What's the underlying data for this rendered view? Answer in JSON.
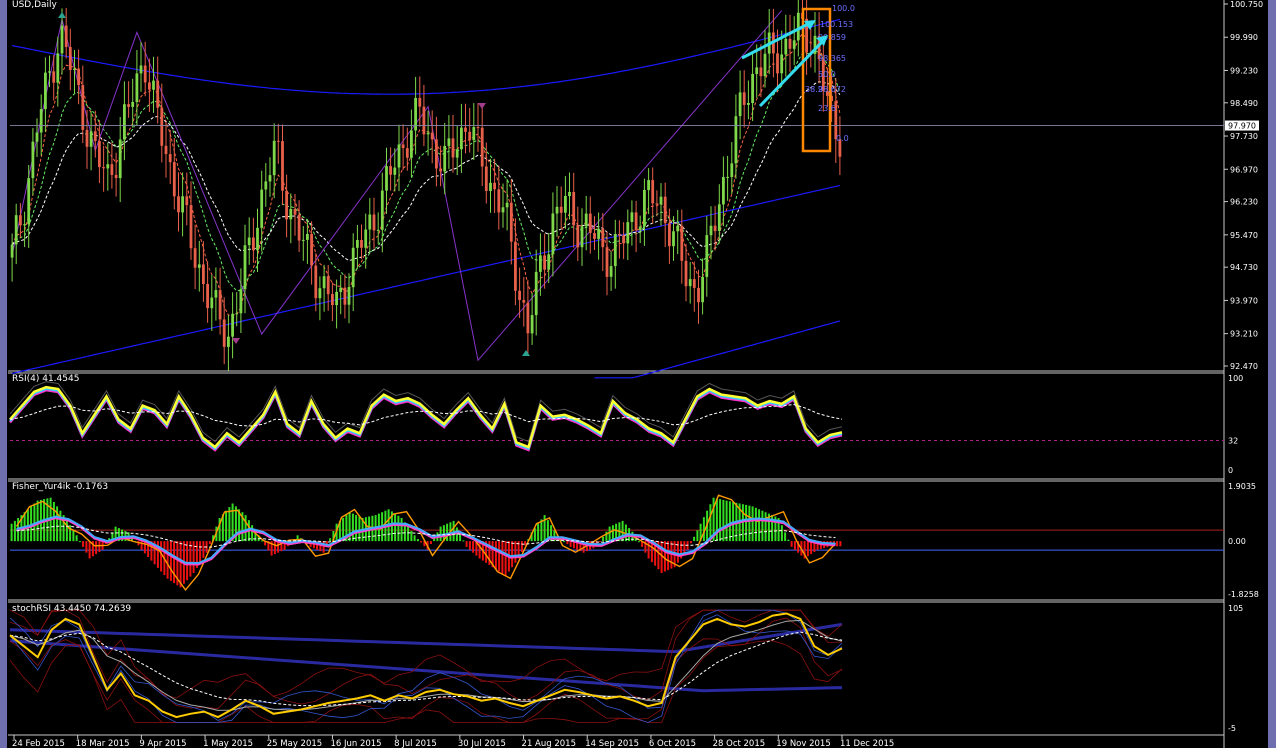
{
  "window": {
    "title": "USD,Daily"
  },
  "colors": {
    "bull": "#7fd84a",
    "bear": "#e8604a",
    "ma_blue": "#1a1aff",
    "rsi_main": "#ffff33",
    "rsi_pink": "#ff33cc",
    "rsi_cyan": "#33ccff",
    "fisher_pos": "#33dd22",
    "fisher_neg": "#ee1111",
    "fisher_line": "#ff9900",
    "stoch_line": "#ffcc00",
    "fib_box": "#ff8800",
    "arrow": "#33ddee"
  },
  "icons": {
    "up_arrow": "arrow-up-icon",
    "down_arrow": "arrow-down-icon"
  },
  "chart_data": [
    {
      "type": "candlestick",
      "title": "USD,Daily",
      "ylim": [
        92.47,
        100.75
      ],
      "y_ticks": [
        "100.750",
        "99.990",
        "99.230",
        "98.490",
        "97.730",
        "96.970",
        "96.230",
        "95.470",
        "94.730",
        "93.970",
        "93.210",
        "92.470"
      ],
      "current_price_label": "97.970",
      "fib_levels": [
        "100.0",
        "100.153",
        "99.859",
        "98.365",
        "50.0",
        "38.2",
        "98.672",
        "23.6",
        "0.0"
      ],
      "x_labels": [
        "24 Feb 2015",
        "18 Mar 2015",
        "9 Apr 2015",
        "1 May 2015",
        "25 May 2015",
        "16 Jun 2015",
        "8 Jul 2015",
        "30 Jul 2015",
        "21 Aug 2015",
        "14 Sep 2015",
        "6 Oct 2015",
        "28 Oct 2015",
        "19 Nov 2015",
        "11 Dec 2015"
      ],
      "close_path": [
        95.0,
        96.2,
        97.8,
        99.0,
        100.1,
        99.2,
        98.2,
        97.2,
        96.8,
        97.6,
        98.6,
        99.6,
        98.2,
        97.2,
        96.2,
        95.2,
        94.4,
        93.6,
        93.2,
        94.2,
        95.4,
        96.6,
        97.4,
        96.2,
        95.4,
        94.8,
        94.2,
        93.8,
        94.6,
        95.2,
        95.8,
        96.4,
        97.2,
        97.8,
        98.2,
        97.6,
        97.0,
        97.6,
        98.1,
        97.2,
        96.6,
        96.0,
        94.6,
        93.3,
        94.6,
        95.8,
        96.2,
        95.8,
        95.6,
        95.2,
        95.0,
        95.4,
        96.0,
        96.3,
        96.2,
        95.6,
        94.6,
        94.2,
        95.0,
        96.4,
        97.4,
        98.6,
        99.3,
        99.5,
        99.7,
        99.9,
        100.2,
        99.8,
        98.3,
        97.8
      ]
    },
    {
      "type": "line",
      "title": "RSI(4) 41.4545",
      "ylim": [
        0,
        100
      ],
      "y_ticks": [
        "100",
        "32",
        "0"
      ],
      "level": 32,
      "values": [
        55,
        70,
        85,
        90,
        88,
        70,
        40,
        60,
        80,
        55,
        45,
        70,
        65,
        50,
        80,
        60,
        35,
        25,
        40,
        30,
        45,
        60,
        85,
        50,
        40,
        75,
        50,
        35,
        45,
        40,
        70,
        82,
        75,
        78,
        72,
        60,
        50,
        65,
        78,
        60,
        45,
        72,
        30,
        25,
        70,
        58,
        60,
        55,
        48,
        40,
        75,
        62,
        55,
        45,
        40,
        30,
        55,
        80,
        88,
        82,
        80,
        78,
        70,
        75,
        72,
        80,
        45,
        30,
        38,
        41
      ]
    },
    {
      "type": "bar",
      "title": "Fisher_Yur4ik -0.1763",
      "ylim": [
        -1.8258,
        1.9035
      ],
      "y_ticks": [
        "1.9035",
        "0.00",
        "-1.8258"
      ],
      "values": [
        0.6,
        1.0,
        1.4,
        1.5,
        0.9,
        0.2,
        -0.6,
        -0.3,
        0.5,
        0.3,
        -0.3,
        -0.8,
        -1.3,
        -1.6,
        -1.1,
        -0.4,
        0.8,
        1.3,
        0.9,
        0.2,
        -0.5,
        -0.3,
        0.2,
        -0.2,
        -0.4,
        0.6,
        1.0,
        0.8,
        0.9,
        1.1,
        0.8,
        0.2,
        -0.3,
        0.5,
        0.7,
        -0.2,
        -0.6,
        -0.9,
        -1.2,
        -0.6,
        0.3,
        0.9,
        0.2,
        -0.2,
        -0.4,
        -0.2,
        0.5,
        0.7,
        0.2,
        -0.6,
        -1.1,
        -0.9,
        -0.3,
        0.6,
        1.5,
        1.4,
        1.3,
        1.2,
        1.0,
        0.8,
        -0.2,
        -0.6,
        -0.3,
        -0.18
      ]
    },
    {
      "type": "line",
      "title": "stochRSI 43.4450 74.2639",
      "ylim": [
        -5,
        105
      ],
      "y_ticks": [
        "105",
        "-5"
      ],
      "values": [
        80,
        70,
        60,
        85,
        95,
        90,
        60,
        30,
        45,
        25,
        20,
        10,
        5,
        8,
        10,
        5,
        12,
        20,
        15,
        8,
        10,
        12,
        15,
        18,
        20,
        22,
        25,
        20,
        25,
        22,
        28,
        30,
        26,
        24,
        20,
        22,
        18,
        15,
        20,
        25,
        30,
        28,
        25,
        22,
        24,
        20,
        15,
        18,
        60,
        75,
        90,
        95,
        90,
        88,
        92,
        98,
        100,
        95,
        70,
        62,
        68
      ]
    }
  ]
}
